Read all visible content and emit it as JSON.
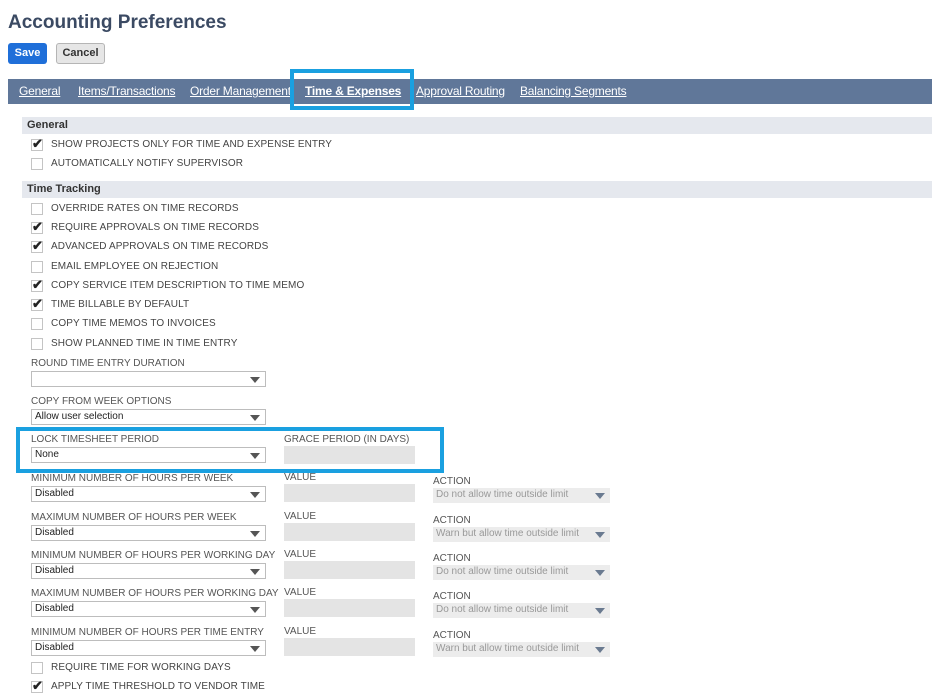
{
  "page": {
    "title": "Accounting Preferences"
  },
  "toolbar": {
    "save_label": "Save",
    "cancel_label": "Cancel"
  },
  "tabs": [
    {
      "label": "General"
    },
    {
      "label": "Items/Transactions"
    },
    {
      "label": "Order Management"
    },
    {
      "label": "Time & Expenses",
      "active": true
    },
    {
      "label": "Approval Routing"
    },
    {
      "label": "Balancing Segments"
    }
  ],
  "sections": {
    "general": "General",
    "time_tracking": "Time Tracking"
  },
  "general_checks": [
    {
      "label": "SHOW PROJECTS ONLY FOR TIME AND EXPENSE ENTRY",
      "checked": true
    },
    {
      "label": "AUTOMATICALLY NOTIFY SUPERVISOR",
      "checked": false
    }
  ],
  "time_checks": [
    {
      "label": "OVERRIDE RATES ON TIME RECORDS",
      "checked": false
    },
    {
      "label": "REQUIRE APPROVALS ON TIME RECORDS",
      "checked": true
    },
    {
      "label": "ADVANCED APPROVALS ON TIME RECORDS",
      "checked": true
    },
    {
      "label": "EMAIL EMPLOYEE ON REJECTION",
      "checked": false
    },
    {
      "label": "COPY SERVICE ITEM DESCRIPTION TO TIME MEMO",
      "checked": true
    },
    {
      "label": "TIME BILLABLE BY DEFAULT",
      "checked": true
    },
    {
      "label": "COPY TIME MEMOS TO INVOICES",
      "checked": false
    },
    {
      "label": "SHOW PLANNED TIME IN TIME ENTRY",
      "checked": false
    }
  ],
  "round_time": {
    "label": "ROUND TIME ENTRY DURATION",
    "value": ""
  },
  "copy_week": {
    "label": "COPY FROM WEEK OPTIONS",
    "value": "Allow user selection"
  },
  "lock_period": {
    "label": "LOCK TIMESHEET PERIOD",
    "value": "None",
    "grace_label": "GRACE PERIOD (IN DAYS)",
    "grace_value": ""
  },
  "limits": [
    {
      "label": "MINIMUM NUMBER OF HOURS PER WEEK",
      "value": "Disabled",
      "value_label": "VALUE",
      "action_label": "ACTION",
      "action_value": "Do not allow time outside limit"
    },
    {
      "label": "MAXIMUM NUMBER OF HOURS PER WEEK",
      "value": "Disabled",
      "value_label": "VALUE",
      "action_label": "ACTION",
      "action_value": "Warn but allow time outside limit"
    },
    {
      "label": "MINIMUM NUMBER OF HOURS PER WORKING DAY",
      "value": "Disabled",
      "value_label": "VALUE",
      "action_label": "ACTION",
      "action_value": "Do not allow time outside limit"
    },
    {
      "label": "MAXIMUM NUMBER OF HOURS PER WORKING DAY",
      "value": "Disabled",
      "value_label": "VALUE",
      "action_label": "ACTION",
      "action_value": "Do not allow time outside limit"
    },
    {
      "label": "MINIMUM NUMBER OF HOURS PER TIME ENTRY",
      "value": "Disabled",
      "value_label": "VALUE",
      "action_label": "ACTION",
      "action_value": "Warn but allow time outside limit"
    }
  ],
  "bottom_checks": [
    {
      "label": "REQUIRE TIME FOR WORKING DAYS",
      "checked": false
    },
    {
      "label": "APPLY TIME THRESHOLD TO VENDOR TIME",
      "checked": true
    }
  ],
  "colors": {
    "tab_bar": "#607799",
    "highlight": "#1aa0e0",
    "save": "#1f6fd9"
  }
}
